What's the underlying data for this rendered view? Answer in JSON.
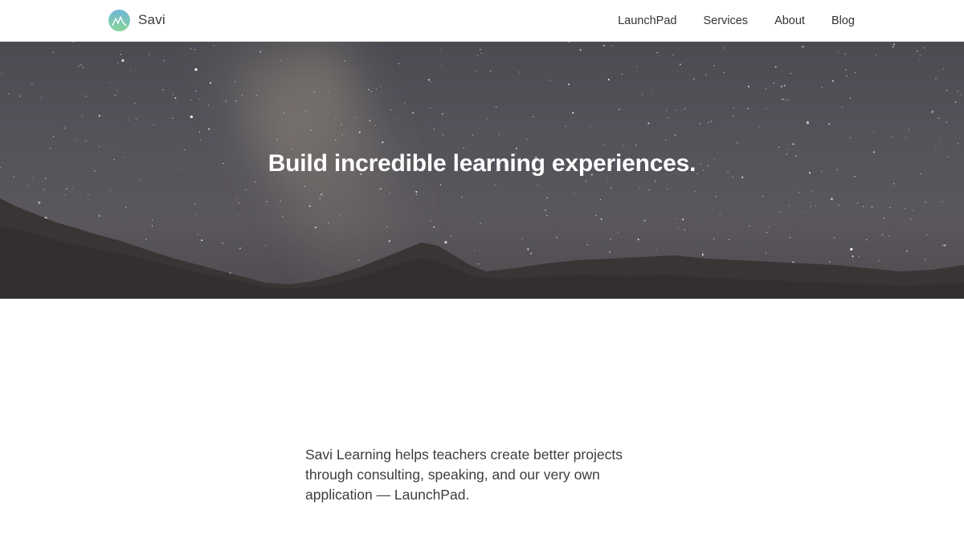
{
  "header": {
    "brand_name": "Savi",
    "logo_icon": "savi-mountain-logo",
    "nav": [
      {
        "label": "LaunchPad"
      },
      {
        "label": "Services"
      },
      {
        "label": "About"
      },
      {
        "label": "Blog"
      }
    ]
  },
  "hero": {
    "title": "Build incredible learning experiences."
  },
  "intro": {
    "text": "Savi Learning helps teachers create better projects through consulting, speaking, and our very own application — LaunchPad."
  },
  "colors": {
    "logo_gradient_top": "#6fb7d6",
    "logo_gradient_bottom": "#7fd39a",
    "hero_text": "#ffffff",
    "body_text": "#3d3d3d"
  }
}
